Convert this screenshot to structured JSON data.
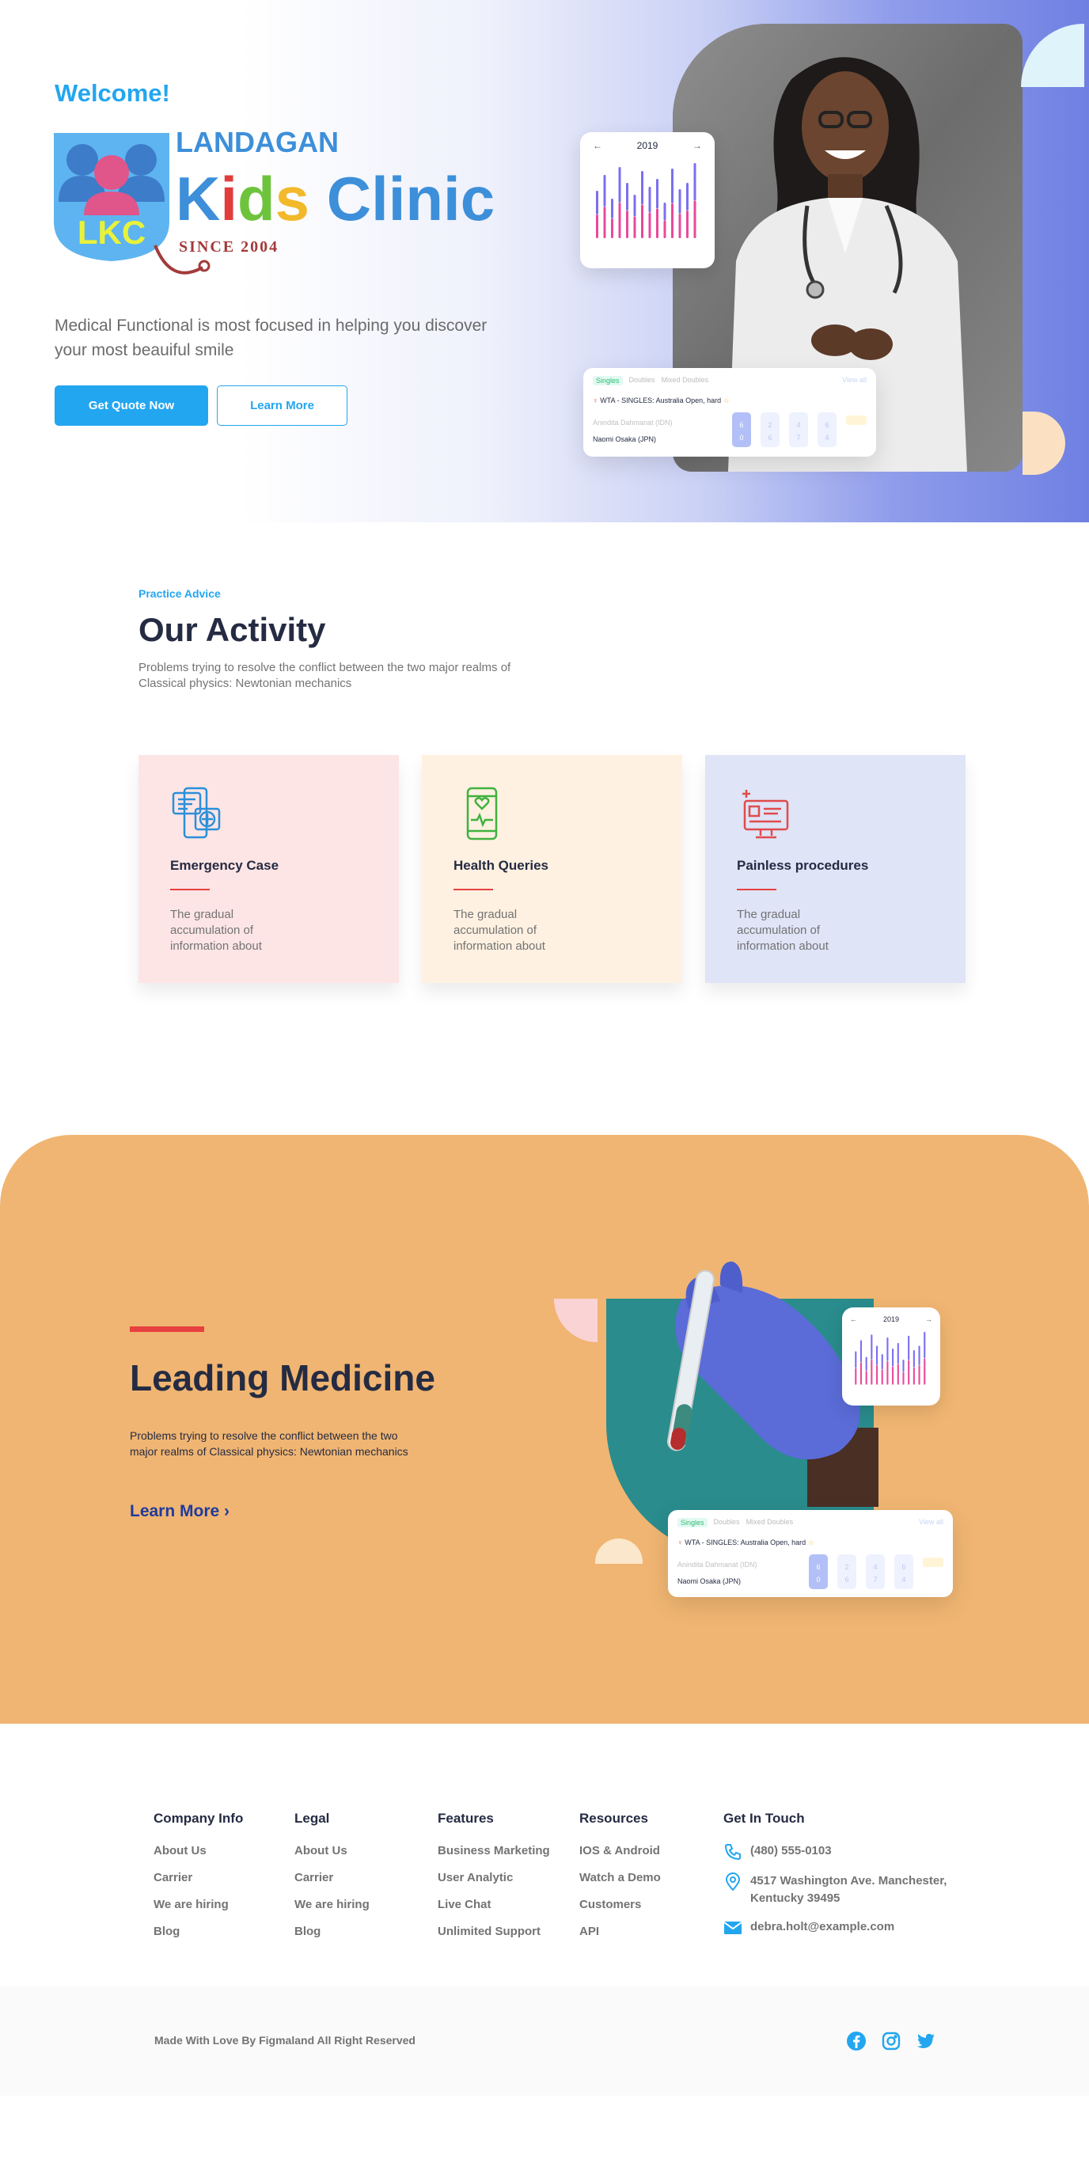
{
  "hero": {
    "welcome": "Welcome!",
    "logo": {
      "line1": "LANDAGAN",
      "line2": "Kids Clinic",
      "badge": "LKC",
      "since": "SINCE 2004"
    },
    "subtitle": "Medical Functional is most focused in helping you discover your most beauiful smile",
    "primary_button": "Get Quote Now",
    "secondary_button": "Learn More"
  },
  "widgets": {
    "chart_year": "2019",
    "arrow_left": "←",
    "arrow_right": "→",
    "match": {
      "tabs": [
        "Singles",
        "Doubles",
        "Mixed Doubles"
      ],
      "view_all": "View all",
      "title": "WTA - SINGLES: Australia Open, hard",
      "player1": "Anindita Dahmanat (IDN)",
      "player2": "Naomi Osaka (JPN)",
      "scores": [
        [
          "6",
          "0"
        ],
        [
          "2",
          "6"
        ],
        [
          "4",
          "7"
        ],
        [
          "6",
          "4"
        ]
      ]
    }
  },
  "activity": {
    "eyebrow": "Practice Advice",
    "title": "Our Activity",
    "subtitle": "Problems trying to resolve the conflict between the two major realms of Classical physics: Newtonian mechanics",
    "cards": [
      {
        "title": "Emergency Case",
        "text": "The gradual accumulation of information about",
        "bg": "#FDE5E6",
        "icon": "emergency-chat-icon"
      },
      {
        "title": "Health Queries",
        "text": "The gradual accumulation of information about",
        "bg": "#FEF1E1",
        "icon": "phone-heart-icon"
      },
      {
        "title": "Painless procedures",
        "text": "The gradual accumulation of information about",
        "bg": "#DFE4F7",
        "icon": "monitor-medical-icon"
      }
    ]
  },
  "leading": {
    "title": "Leading Medicine",
    "subtitle": "Problems trying to resolve the conflict between the two major realms of Classical physics: Newtonian mechanics",
    "link": "Learn More",
    "chevron": "›"
  },
  "footer": {
    "columns": [
      {
        "title": "Company Info",
        "links": [
          "About Us",
          "Carrier",
          "We are hiring",
          "Blog"
        ]
      },
      {
        "title": "Legal",
        "links": [
          "About Us",
          "Carrier",
          "We are hiring",
          "Blog"
        ]
      },
      {
        "title": "Features",
        "links": [
          "Business Marketing",
          "User Analytic",
          "Live Chat",
          "Unlimited Support"
        ]
      },
      {
        "title": "Resources",
        "links": [
          "IOS & Android",
          "Watch a Demo",
          "Customers",
          "API"
        ]
      }
    ],
    "contact": {
      "title": "Get In Touch",
      "phone": "(480) 555-0103",
      "address": "4517 Washington Ave. Manchester, Kentucky 39495",
      "email": "debra.holt@example.com"
    },
    "copyright": "Made With Love By Figmaland All Right Reserved",
    "social": [
      "facebook-icon",
      "instagram-icon",
      "twitter-icon"
    ]
  },
  "colors": {
    "primary": "#23A6F0",
    "dark": "#252B42",
    "muted": "#737373",
    "accent_red": "#E74040",
    "orange": "#F0B572",
    "teal": "#2A8C8D"
  }
}
